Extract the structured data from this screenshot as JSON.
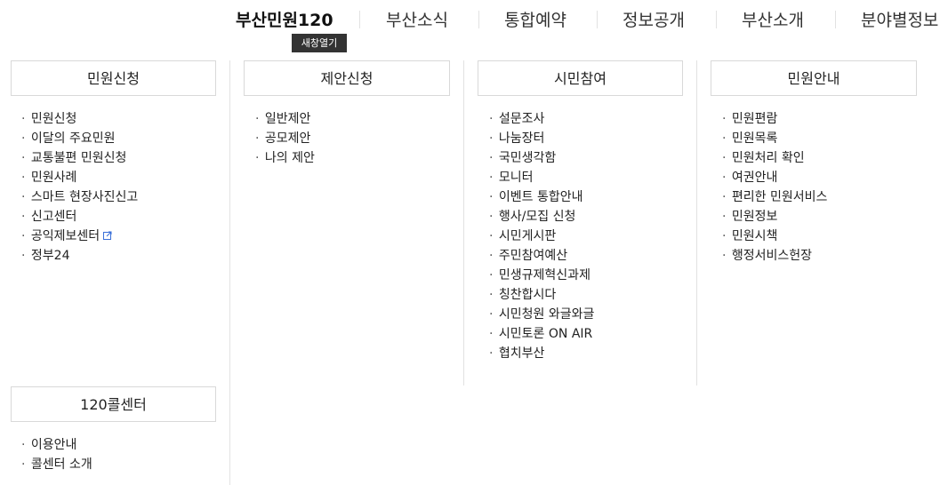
{
  "nav": {
    "items": [
      "부산민원120",
      "부산소식",
      "통합예약",
      "정보공개",
      "부산소개",
      "분야별정보"
    ],
    "tooltip": "새창열기"
  },
  "columns": [
    {
      "title": "민원신청",
      "items": [
        "민원신청",
        "이달의 주요민원",
        "교통불편 민원신청",
        "민원사례",
        "스마트 현장사진신고",
        "신고센터",
        "공익제보센터",
        "정부24"
      ]
    },
    {
      "title": "제안신청",
      "items": [
        "일반제안",
        "공모제안",
        "나의 제안"
      ]
    },
    {
      "title": "시민참여",
      "items": [
        "설문조사",
        "나눔장터",
        "국민생각함",
        "모니터",
        "이벤트 통합안내",
        "행사/모집 신청",
        "시민게시판",
        "주민참여예산",
        "민생규제혁신과제",
        "칭찬합시다",
        "시민청원 와글와글",
        "시민토론 ON AIR",
        "협치부산"
      ]
    },
    {
      "title": "민원안내",
      "items": [
        "민원편람",
        "민원목록",
        "민원처리 확인",
        "여권안내",
        "편리한 민원서비스",
        "민원정보",
        "민원시책",
        "행정서비스헌장"
      ]
    },
    {
      "title": "120콜센터",
      "items": [
        "이용안내",
        "콜센터 소개"
      ]
    }
  ],
  "colors": {
    "border": "#d9d9d9",
    "divider": "#e2e2e2",
    "tooltip_bg": "#333333",
    "text": "#222222"
  },
  "icons": {
    "external_link": "external-link-icon"
  }
}
